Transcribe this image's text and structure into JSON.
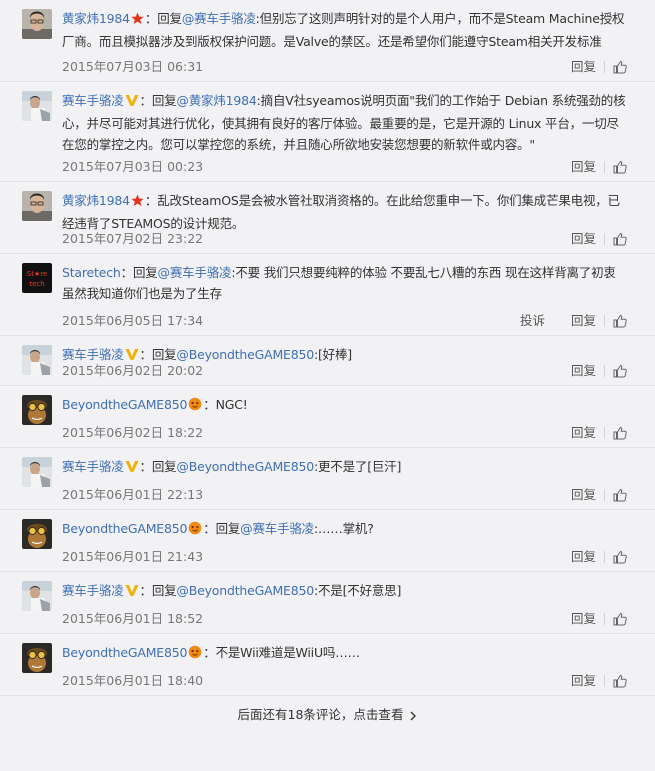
{
  "comments": [
    {
      "user": "黄家炜1984",
      "badge": "star-red",
      "prefix": "：回复",
      "mention": "@赛车手骆凌",
      "body": ":但别忘了这则声明针对的是个人用户，而不是Steam Machine授权厂商。而且模拟器涉及到版权保护问题。是Valve的禁区。还是希望你们能遵守Steam相关开发标准",
      "time": "2015年07月03日 06:31",
      "reply": "回复",
      "avatar": "man-selfie-icon"
    },
    {
      "user": "赛车手骆凌",
      "badge": "v-yellow",
      "prefix": "：回复",
      "mention": "@黄家炜1984",
      "body": ":摘自V社syeamos说明页面\"我们的工作始于 Debian 系统强劲的核心，并尽可能对其进行优化，使其拥有良好的客厅体验。最重要的是，它是开源的 Linux 平台，一切尽在您的掌控之内。您可以掌控您的系统，并且随心所欲地安装您想要的新软件或内容。\"",
      "time": "2015年07月03日 00:23",
      "reply": "回复",
      "avatar": "driver-icon"
    },
    {
      "user": "黄家炜1984",
      "badge": "star-red",
      "prefix": "：",
      "mention": "",
      "body": "乱改SteamOS是会被水管社取消资格的。在此给您重申一下。你们集成芒果电视，已经违背了STEAMOS的设计规范。",
      "time": "2015年07月02日 23:22",
      "reply": "回复",
      "avatar": "man-selfie-icon"
    },
    {
      "user": "Staretech",
      "badge": "",
      "prefix": "：回复",
      "mention": "@赛车手骆凌",
      "body": ":不要 我们只想要纯粹的体验 不要乱七八糟的东西 现在这样背离了初衷 虽然我知道你们也是为了生存",
      "time": "2015年06月05日 17:34",
      "reply": "回复",
      "report": "投诉",
      "avatar": "staretech-logo-icon"
    },
    {
      "user": "赛车手骆凌",
      "badge": "v-yellow",
      "prefix": "：回复",
      "mention": "@BeyondtheGAME850",
      "body": ":[好棒]",
      "time": "2015年06月02日 20:02",
      "reply": "回复",
      "avatar": "driver-icon"
    },
    {
      "user": "BeyondtheGAME850",
      "badge": "fan-orange",
      "prefix": "：",
      "mention": "",
      "body": "NGC!",
      "time": "2015年06月02日 18:22",
      "reply": "回复",
      "avatar": "goggles-character-icon"
    },
    {
      "user": "赛车手骆凌",
      "badge": "v-yellow",
      "prefix": "：回复",
      "mention": "@BeyondtheGAME850",
      "body": ":更不是了[巨汗]",
      "time": "2015年06月01日 22:13",
      "reply": "回复",
      "avatar": "driver-icon"
    },
    {
      "user": "BeyondtheGAME850",
      "badge": "fan-orange",
      "prefix": "：回复",
      "mention": "@赛车手骆凌",
      "body": ":……掌机?",
      "time": "2015年06月01日 21:43",
      "reply": "回复",
      "avatar": "goggles-character-icon"
    },
    {
      "user": "赛车手骆凌",
      "badge": "v-yellow",
      "prefix": "：回复",
      "mention": "@BeyondtheGAME850",
      "body": ":不是[不好意思]",
      "time": "2015年06月01日 18:52",
      "reply": "回复",
      "avatar": "driver-icon"
    },
    {
      "user": "BeyondtheGAME850",
      "badge": "fan-orange",
      "prefix": "：",
      "mention": "",
      "body": "不是Wii难道是WiiU吗……",
      "time": "2015年06月01日 18:40",
      "reply": "回复",
      "avatar": "goggles-character-icon"
    }
  ],
  "footer": {
    "more_text": "后面还有18条评论，点击查看",
    "chevron": "chevron-right-icon"
  },
  "colors": {
    "link": "#3f6fb3",
    "background": "#f2f2f5",
    "star_badge": "#e2341f",
    "v_badge": "#f2b10a",
    "fan_badge": "#f08a12"
  }
}
